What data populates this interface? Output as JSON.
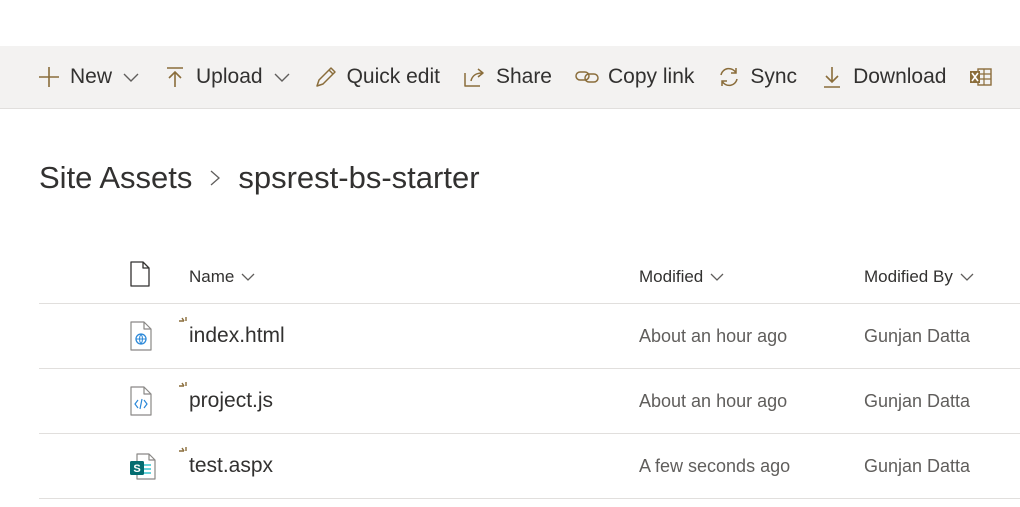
{
  "command_bar": {
    "new_label": "New",
    "upload_label": "Upload",
    "quick_edit_label": "Quick edit",
    "share_label": "Share",
    "copy_link_label": "Copy link",
    "sync_label": "Sync",
    "download_label": "Download"
  },
  "breadcrumb": {
    "items": [
      "Site Assets",
      "spsrest-bs-starter"
    ]
  },
  "list": {
    "columns": {
      "name": "Name",
      "modified": "Modified",
      "modified_by": "Modified By"
    },
    "rows": [
      {
        "name": "index.html",
        "modified": "About an hour ago",
        "modified_by": "Gunjan Datta",
        "icon": "html-file-icon"
      },
      {
        "name": "project.js",
        "modified": "About an hour ago",
        "modified_by": "Gunjan Datta",
        "icon": "code-file-icon"
      },
      {
        "name": "test.aspx",
        "modified": "A few seconds ago",
        "modified_by": "Gunjan Datta",
        "icon": "sharepoint-page-icon"
      }
    ]
  },
  "colors": {
    "accent": "#8a6d3b",
    "bar_bg": "#f3f2f1",
    "text": "#323130",
    "muted": "#605e5c",
    "divider": "#e1dfdd",
    "sharepoint_teal": "#036c70"
  }
}
